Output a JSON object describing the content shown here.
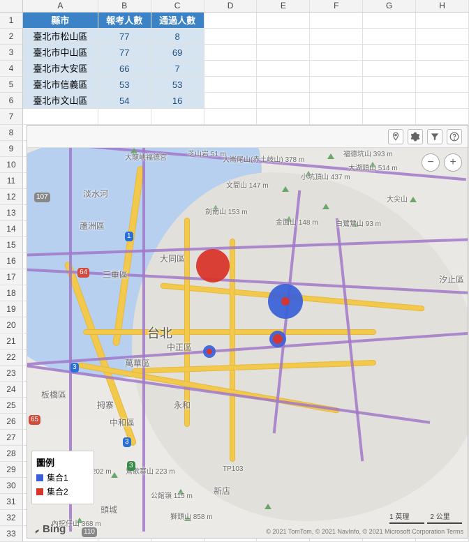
{
  "columns": [
    "A",
    "B",
    "C",
    "D",
    "E",
    "F",
    "G",
    "H"
  ],
  "row_count": 33,
  "table": {
    "headers": [
      "縣市",
      "報考人數",
      "通過人數"
    ],
    "rows": [
      {
        "a": "臺北市松山區",
        "b": "77",
        "c": "8"
      },
      {
        "a": "臺北市中山區",
        "b": "77",
        "c": "69"
      },
      {
        "a": "臺北市大安區",
        "b": "66",
        "c": "7"
      },
      {
        "a": "臺北市信義區",
        "b": "53",
        "c": "53"
      },
      {
        "a": "臺北市文山區",
        "b": "54",
        "c": "16"
      }
    ]
  },
  "toolbar": {
    "pin": "pin",
    "gear": "gear",
    "filter": "filter",
    "help": "help"
  },
  "zoom": {
    "out": "−",
    "in": "+"
  },
  "legend": {
    "title": "圖例",
    "items": [
      {
        "label": "集合1",
        "color": "blue"
      },
      {
        "label": "集合2",
        "color": "red"
      }
    ]
  },
  "bing": "Bing",
  "map_labels": {
    "tamsui": "淡水河",
    "luzhou": "蘆洲區",
    "sanchong": "三重區",
    "datong": "大同區",
    "taipei": "台北",
    "zhongzheng": "中正區",
    "wanhua": "萬華區",
    "banqiao": "板橋區",
    "yonghe": "永和",
    "zhonghe": "中和區",
    "xindian": "新店",
    "xizhi": "汐止區",
    "tucheng": "頭城",
    "zhishan": "芝山岩 51 m",
    "dalongdong": "大龍峽福德宮",
    "wenjianshan": "文間山 147 m",
    "jiannan": "劍南山 153 m",
    "jinmian": "金面山 148 m",
    "fude": "福德坑山 393 m",
    "beiwan": "白鷺鷥山 93 m",
    "dahu": "大湖頭山 514 m",
    "xiaokeng": "小坑頂山 437 m",
    "dakeng": "大崙尾山(赤土岐山) 378 m",
    "dajian": "大尖山",
    "neihu": "拇寨",
    "bishan": "鶯歌寨山 223 m",
    "neibakeshan": "內挖仔山 368 m",
    "gongguanshan": "公館嶺 115 m",
    "dawenjian": "大尖山 202 m",
    "shilin": "獅頭山 858 m",
    "tp103": "TP103",
    "motorway1": "1",
    "motorway3": "3",
    "num64": "64",
    "num65": "65",
    "num107": "107",
    "num3b": "3",
    "num110": "110"
  },
  "scale": {
    "l": "1 英理",
    "r": "2 公里"
  },
  "copyright": "© 2021 TomTom, © 2021 NavInfo, © 2021 Microsoft Corporation  Terms"
}
